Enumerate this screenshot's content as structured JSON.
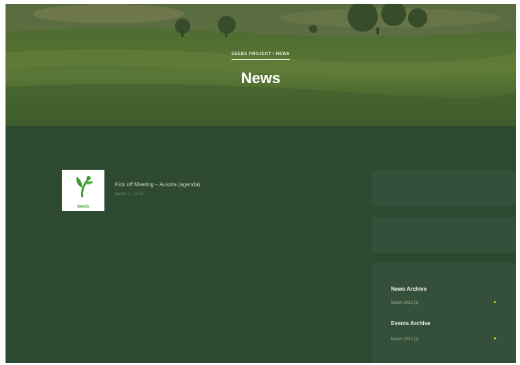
{
  "header": {
    "breadcrumb": "SEEDS PROJECT / NEWS",
    "title": "News"
  },
  "posts": [
    {
      "title": "Kick off Meeting – Austria (agenda)",
      "date": "March 11, 2022",
      "thumbnail_label": "Seeds"
    }
  ],
  "sidebar": {
    "news_archive": {
      "title": "News Archive",
      "items": [
        {
          "label": "March 2022 (1)",
          "icon": "arrow-right-icon"
        }
      ]
    },
    "events_archive": {
      "title": "Events Archive",
      "items": [
        {
          "label": "March 2022 (1)",
          "icon": "arrow-right-icon"
        }
      ]
    }
  },
  "colors": {
    "background": "#2d4a30",
    "widget": "#34503a",
    "accent": "#d9e84a",
    "logo_green": "#3a9a2e"
  }
}
